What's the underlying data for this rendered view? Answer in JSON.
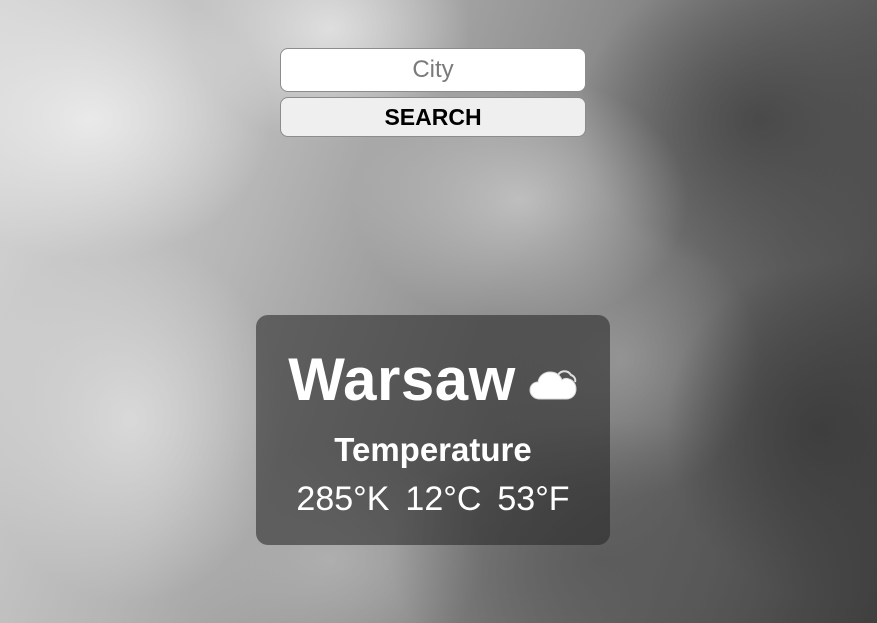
{
  "search": {
    "placeholder": "City",
    "value": "",
    "button_label": "SEARCH"
  },
  "weather": {
    "city": "Warsaw",
    "icon": "cloud-icon",
    "temperature_label": "Temperature",
    "kelvin": "285°K",
    "celsius": "12°C",
    "fahrenheit": "53°F"
  },
  "colors": {
    "card_background": "#282828",
    "text": "#ffffff",
    "button_background": "#efefef"
  }
}
